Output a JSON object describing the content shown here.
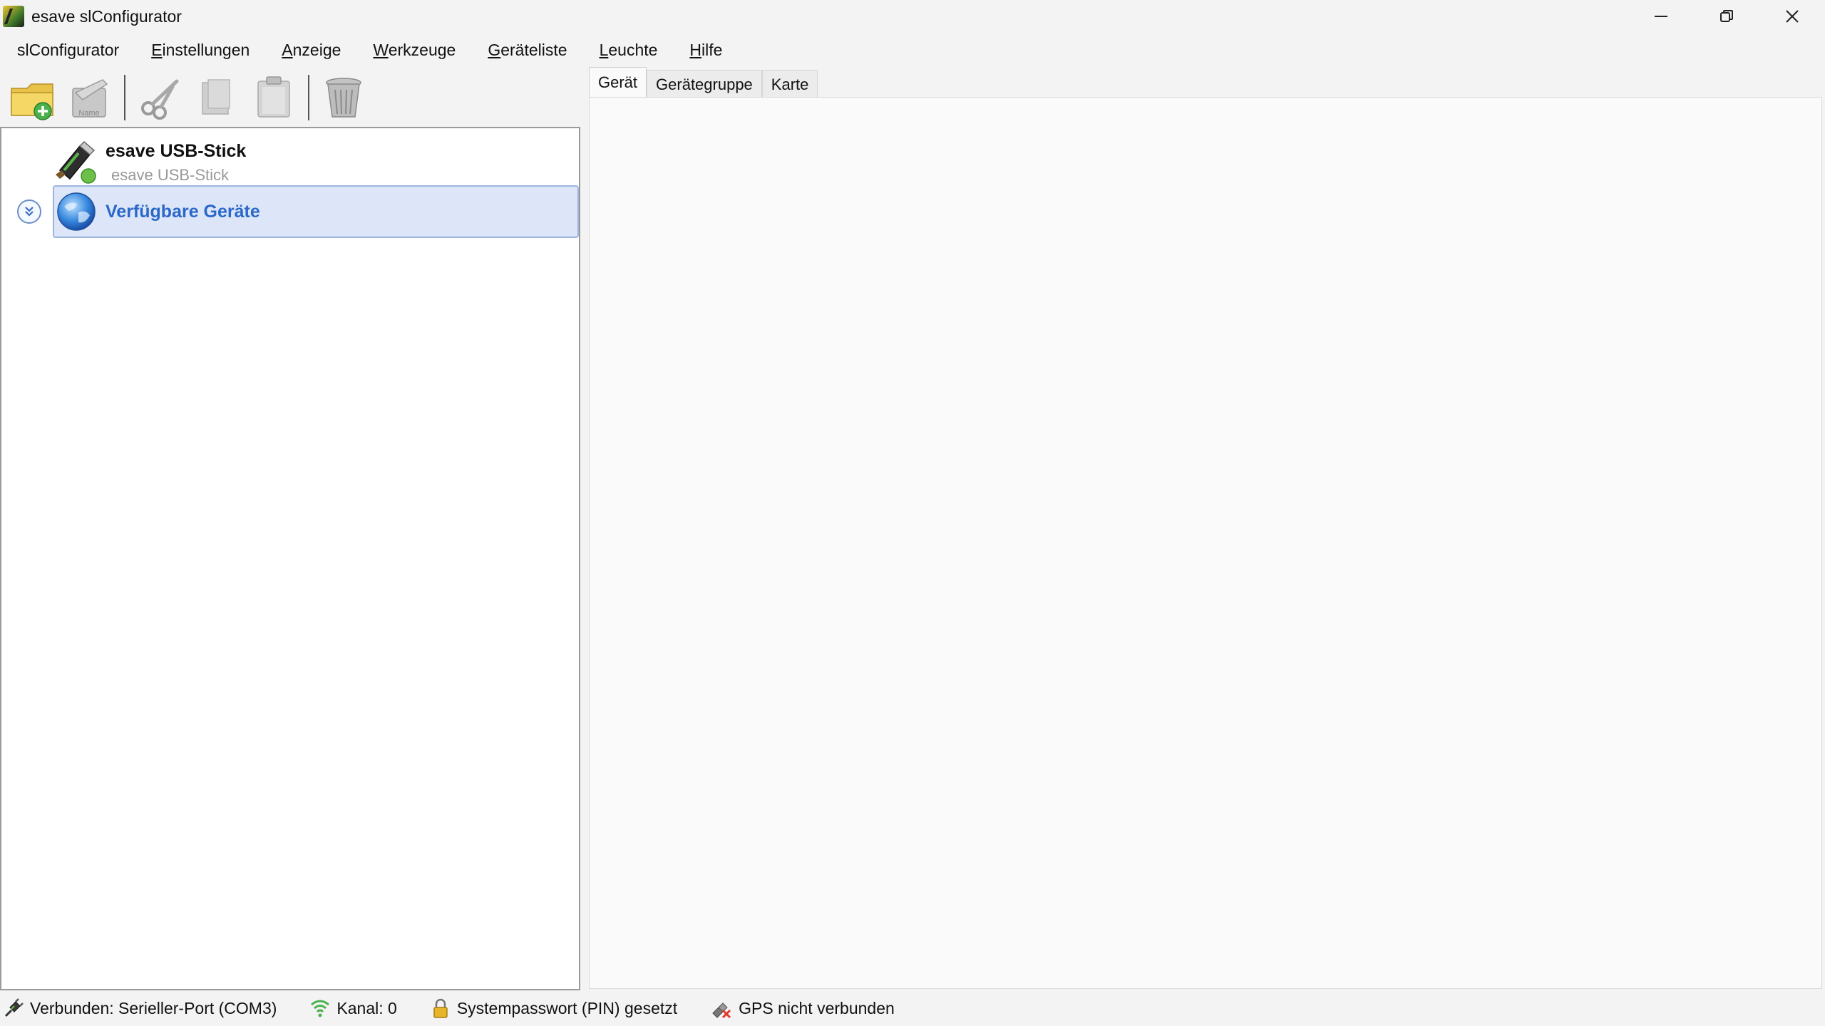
{
  "window": {
    "title": "esave slConfigurator",
    "icon": "app-logo-icon",
    "controls": [
      "minimize-icon",
      "restore-icon",
      "close-icon"
    ]
  },
  "menu": {
    "items": [
      {
        "label": "slConfigurator",
        "accel": ""
      },
      {
        "label": "Einstellungen",
        "accel": "E"
      },
      {
        "label": "Anzeige",
        "accel": "A"
      },
      {
        "label": "Werkzeuge",
        "accel": "W"
      },
      {
        "label": "Geräteliste",
        "accel": "G"
      },
      {
        "label": "Leuchte",
        "accel": "L"
      },
      {
        "label": "Hilfe",
        "accel": "H"
      }
    ]
  },
  "toolbar": {
    "rename_badge": "Name",
    "buttons": [
      "new-folder-icon",
      "rename-icon",
      "cut-icon",
      "copy-icon",
      "paste-icon",
      "delete-icon"
    ]
  },
  "tree": {
    "usb": {
      "title": "esave USB-Stick",
      "subtitle": "esave USB-Stick"
    },
    "available": {
      "label": "Verfügbare Geräte"
    }
  },
  "tabs": [
    {
      "label": "Gerät",
      "active": true
    },
    {
      "label": "Gerätegruppe",
      "active": false
    },
    {
      "label": "Karte",
      "active": false
    }
  ],
  "status": {
    "connection": "Verbunden: Serieller-Port (COM3)",
    "channel": "Kanal: 0",
    "password": "Systempasswort (PIN) gesetzt",
    "gps": "GPS nicht verbunden"
  },
  "colors": {
    "selection_bg": "#dde6f8",
    "selection_text": "#2a68c9",
    "accent_green": "#3fae3f"
  }
}
